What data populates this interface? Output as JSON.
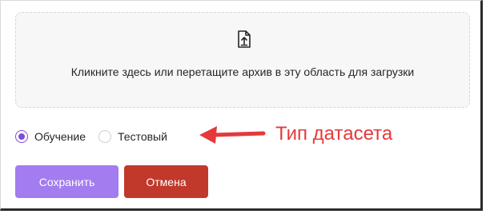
{
  "upload": {
    "text": "Кликните здесь или перетащите архив в эту область для загрузки",
    "icon": "file-upload-icon"
  },
  "dataset_type": {
    "options": [
      {
        "label": "Обучение",
        "checked": true
      },
      {
        "label": "Тестовый",
        "checked": false
      }
    ]
  },
  "annotation": {
    "text": "Тип датасета",
    "color": "#e5393b"
  },
  "buttons": {
    "save_label": "Сохранить",
    "cancel_label": "Отмена"
  },
  "colors": {
    "accent": "#7d4cdb",
    "save_button": "#a37cf0",
    "cancel_button": "#c0392b"
  }
}
